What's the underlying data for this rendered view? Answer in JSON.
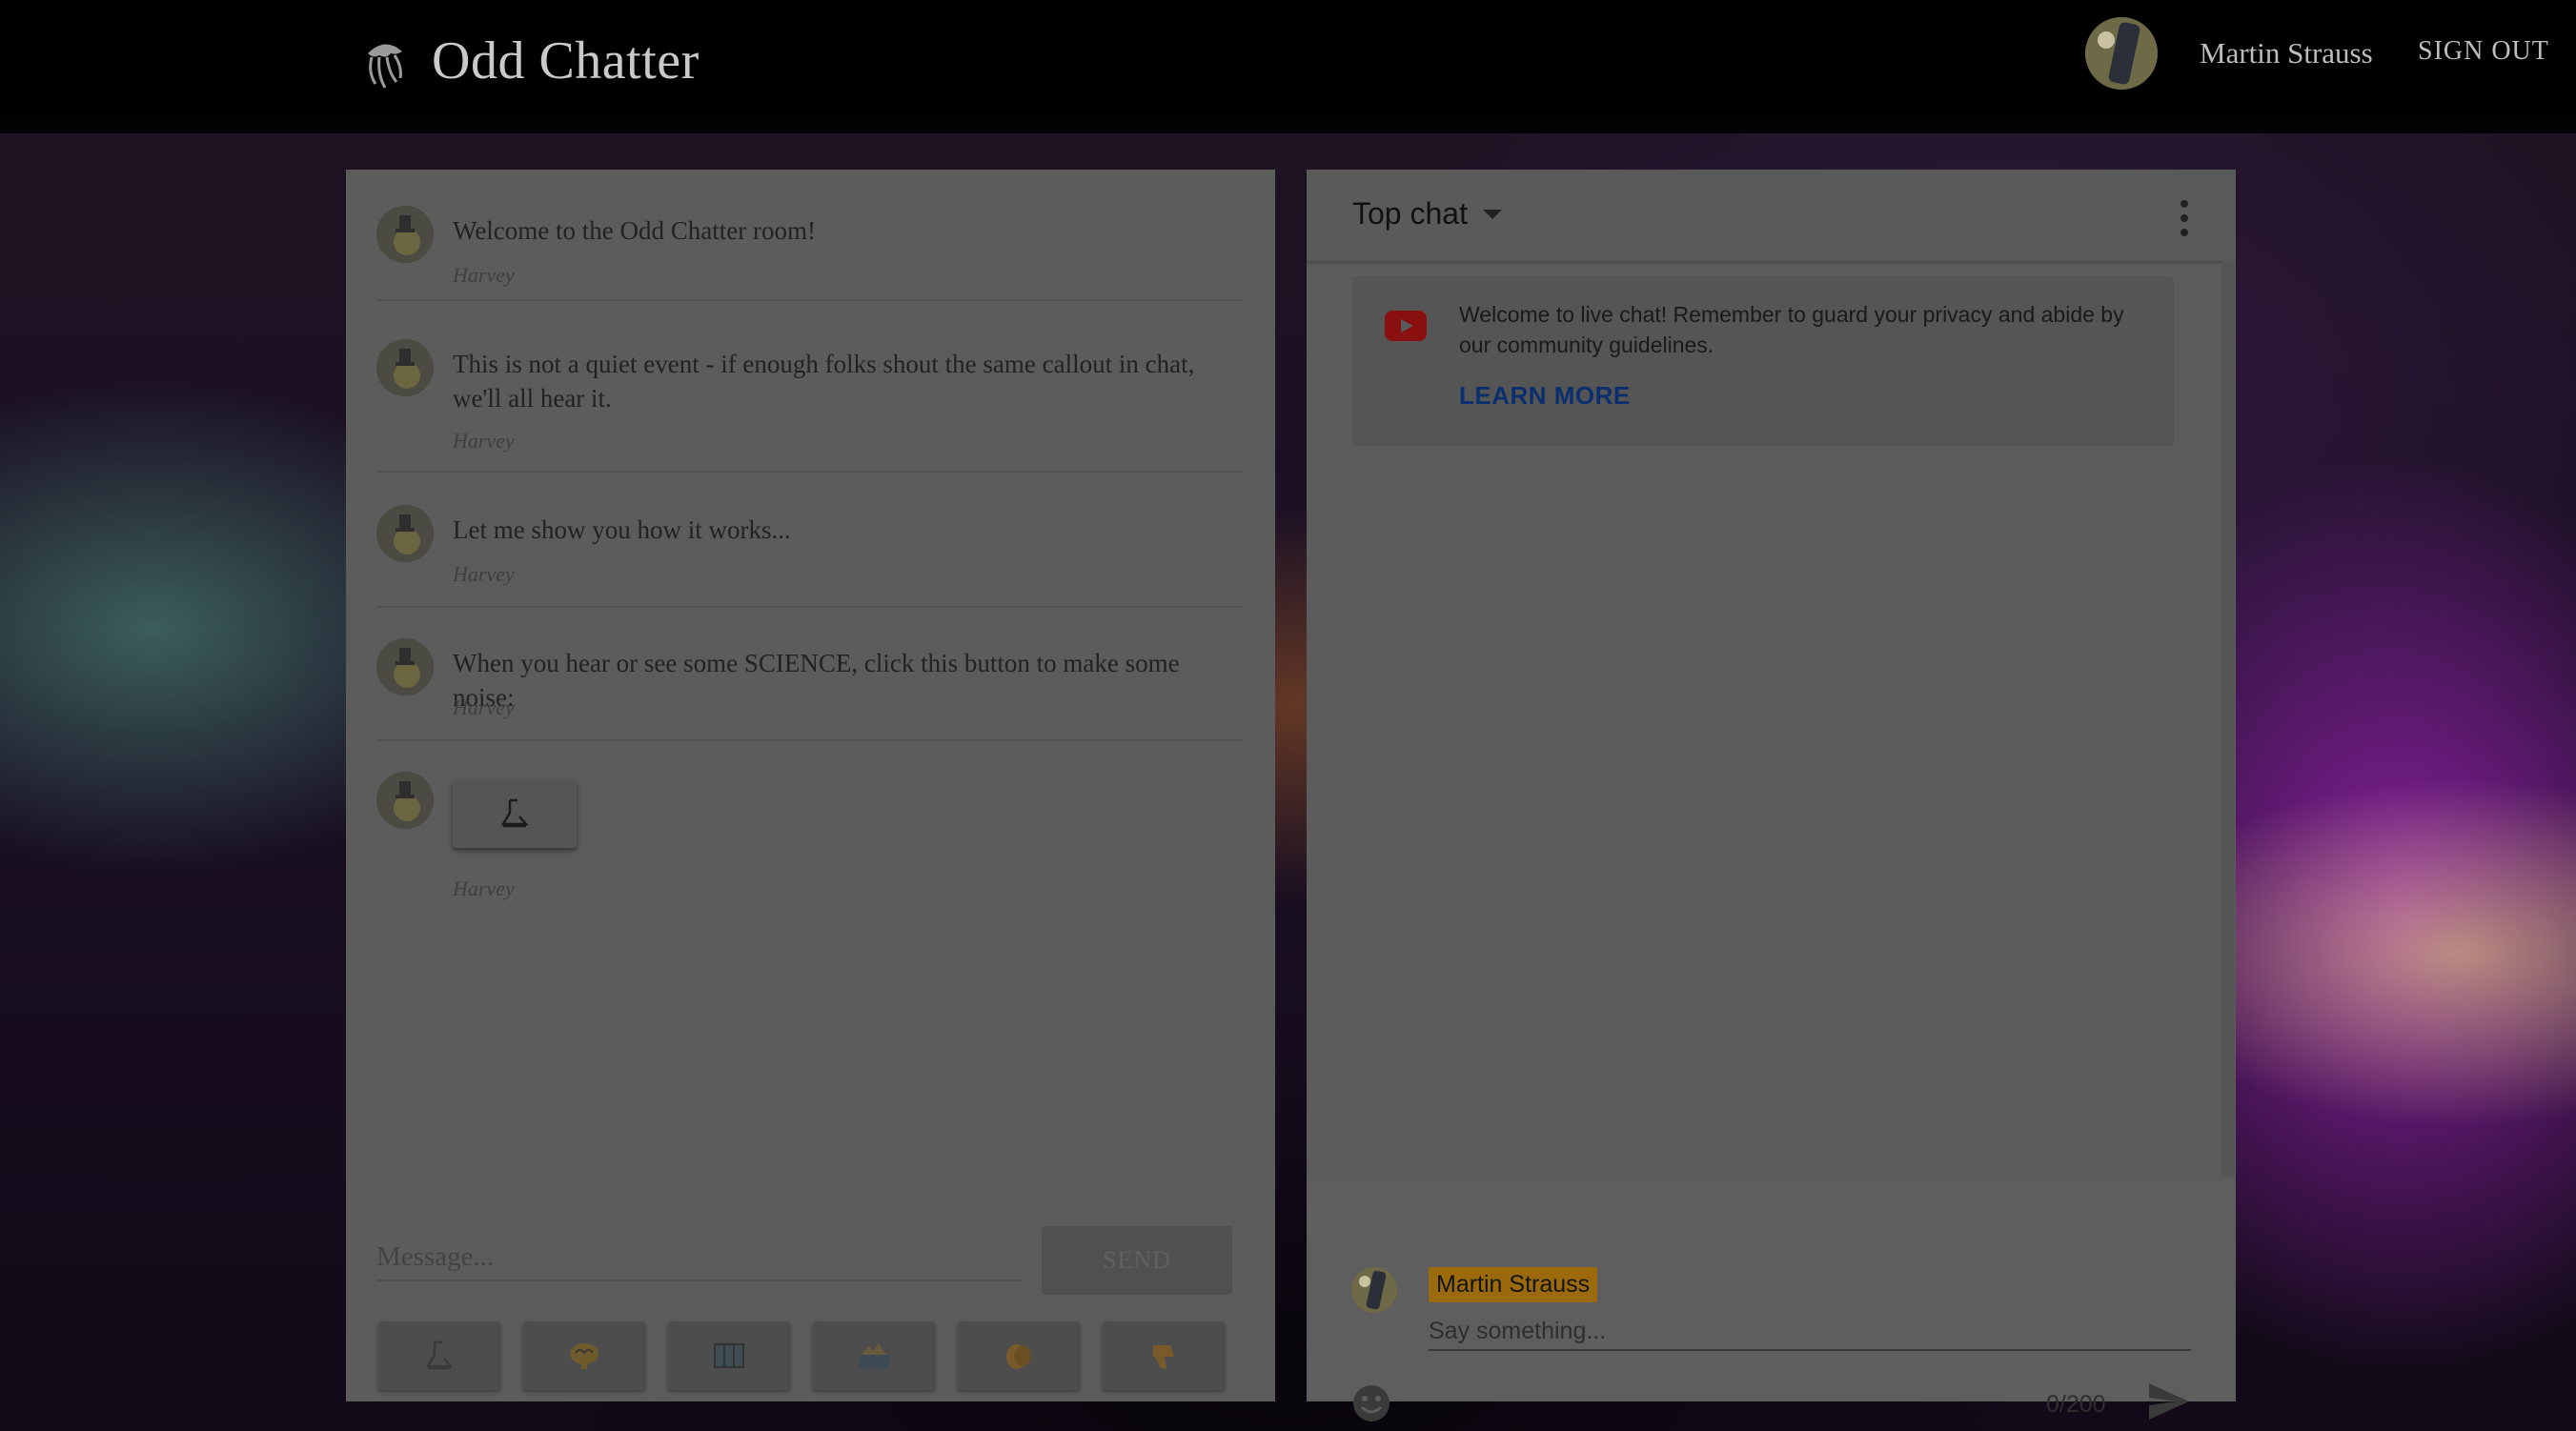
{
  "app": {
    "title": "Odd Chatter",
    "logo_icon": "jellyfish-logo-icon"
  },
  "header": {
    "user_name": "Martin Strauss",
    "sign_out_label": "SIGN OUT"
  },
  "room_chat": {
    "messages": [
      {
        "text": "Welcome to the Odd Chatter room!",
        "author": "Harvey"
      },
      {
        "text": "This is not a quiet event - if enough folks shout the same callout in chat, we'll all hear it.",
        "author": "Harvey"
      },
      {
        "text": "Let me show you how it works...",
        "author": "Harvey"
      },
      {
        "text": "When you hear or see some SCIENCE, click this button to make some noise:",
        "author": "Harvey"
      },
      {
        "text": "",
        "author": "Harvey",
        "button_icon": "science-flask-icon"
      }
    ],
    "message_placeholder": "Message...",
    "send_label": "SEND",
    "callout_buttons": [
      {
        "name": "science",
        "icon": "science-flask-icon"
      },
      {
        "name": "brain",
        "icon": "brain-icon"
      },
      {
        "name": "map",
        "icon": "map-icon"
      },
      {
        "name": "sea",
        "icon": "sea-wave-icon"
      },
      {
        "name": "clap",
        "icon": "clapping-hands-icon"
      },
      {
        "name": "thumbs-down",
        "icon": "thumbs-down-icon"
      }
    ]
  },
  "live_chat": {
    "mode_label": "Top chat",
    "notice_text": "Welcome to live chat! Remember to guard your privacy and abide by our community guidelines.",
    "learn_more_label": "LEARN MORE",
    "author_name": "Martin Strauss",
    "input_placeholder": "Say something...",
    "char_counter": "0/200"
  },
  "colors": {
    "author_chip": "#9a6a0c",
    "learn_more": "#0b2f6e",
    "youtube_red": "#8a0f0f"
  }
}
